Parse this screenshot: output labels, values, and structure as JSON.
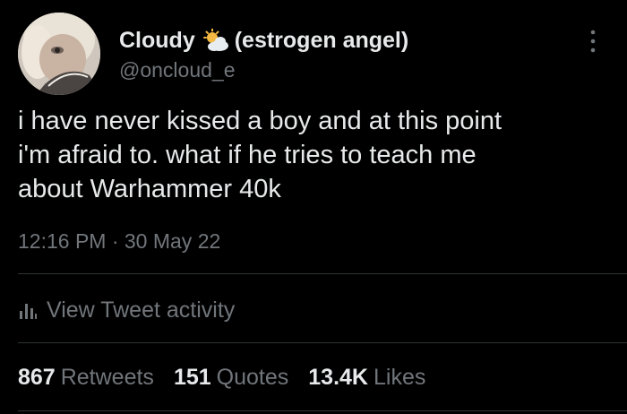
{
  "tweet": {
    "author": {
      "display_name": "Cloudy",
      "display_name_suffix": "(estrogen angel)",
      "name_emoji": "sun-behind-cloud-icon",
      "handle": "@oncloud_e"
    },
    "text": "i have never kissed a boy and at this point\ni'm afraid to. what if he tries to teach me\nabout Warhammer 40k",
    "timestamp": "12:16 PM · 30 May 22",
    "activity_label": "View Tweet activity",
    "stats": {
      "retweets": {
        "count": "867",
        "label": "Retweets"
      },
      "quotes": {
        "count": "151",
        "label": "Quotes"
      },
      "likes": {
        "count": "13.4K",
        "label": "Likes"
      }
    }
  },
  "colors": {
    "background": "#000000",
    "primary_text": "#e7e9ea",
    "secondary_text": "#71767b",
    "divider": "#2f3336"
  }
}
